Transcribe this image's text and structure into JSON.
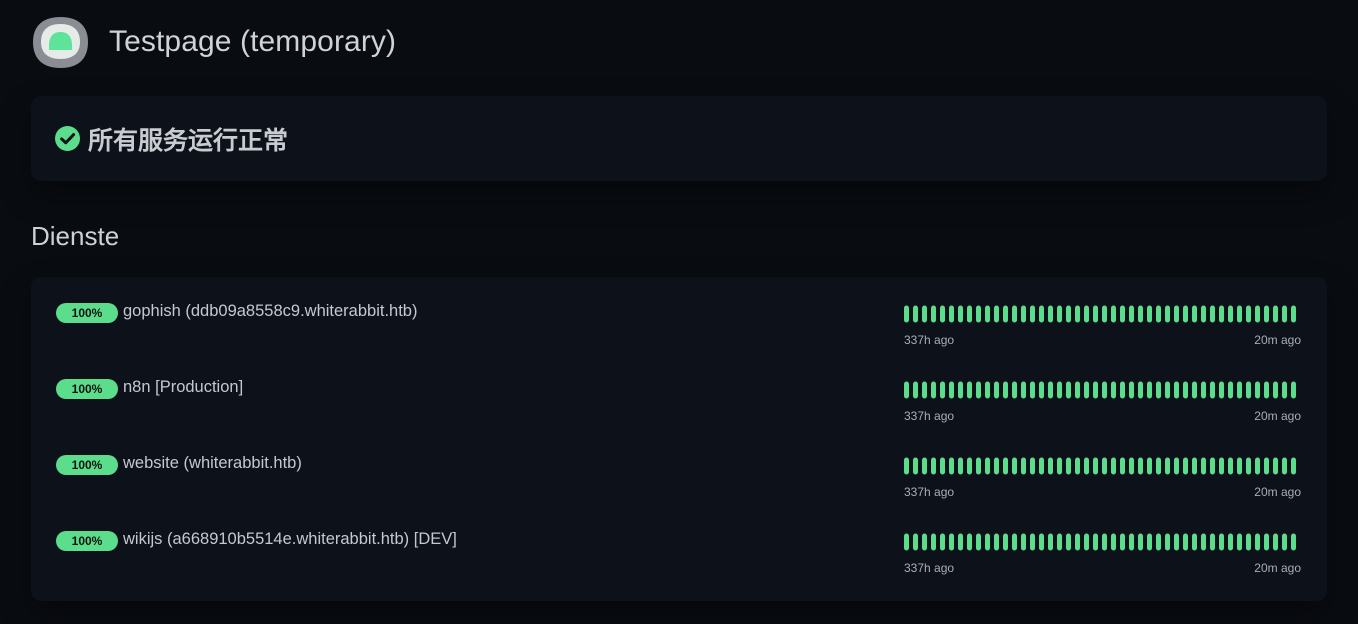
{
  "header": {
    "title": "Testpage (temporary)",
    "logo_icon": "kuma-logo-icon"
  },
  "overall_status": {
    "text": "所有服务运行正常",
    "icon": "check-circle-icon",
    "color": "#5cdd8b"
  },
  "section": {
    "title": "Dienste"
  },
  "colors": {
    "up": "#5cdd8b",
    "background": "#090c11",
    "card": "#0d1119"
  },
  "services": [
    {
      "uptime": "100%",
      "name": "gophish (ddb09a8558c9.whiterabbit.htb)",
      "heartbeat_count": 44,
      "heartbeat_status": "up",
      "range_start": "337h ago",
      "range_end": "20m ago"
    },
    {
      "uptime": "100%",
      "name": "n8n [Production]",
      "heartbeat_count": 44,
      "heartbeat_status": "up",
      "range_start": "337h ago",
      "range_end": "20m ago"
    },
    {
      "uptime": "100%",
      "name": "website (whiterabbit.htb)",
      "heartbeat_count": 44,
      "heartbeat_status": "up",
      "range_start": "337h ago",
      "range_end": "20m ago"
    },
    {
      "uptime": "100%",
      "name": "wikijs (a668910b5514e.whiterabbit.htb) [DEV]",
      "heartbeat_count": 44,
      "heartbeat_status": "up",
      "range_start": "337h ago",
      "range_end": "20m ago"
    }
  ]
}
